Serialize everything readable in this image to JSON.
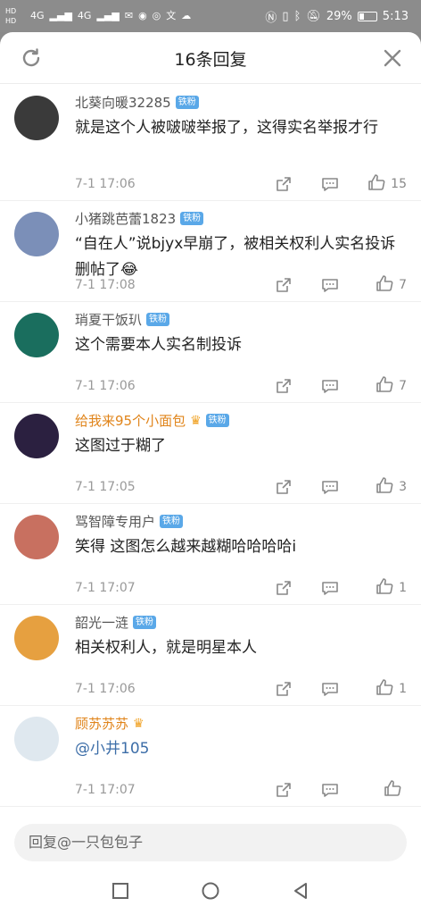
{
  "status": {
    "hd": "HD",
    "network": "4G",
    "battery": "29%",
    "time": "5:13"
  },
  "header": {
    "title": "16条回复"
  },
  "fan_badge": "铁粉",
  "comments": [
    {
      "name": "北葵向暖32285",
      "highlight": false,
      "crown": false,
      "badge": true,
      "text": "就是这个人被啵啵举报了，这得实名举报才行",
      "time": "7-1 17:06",
      "likes": "15",
      "avatar_color": "#3a3a3a"
    },
    {
      "name": "小猪跳芭蕾1823",
      "highlight": false,
      "crown": false,
      "badge": true,
      "text": "“自在人”说bjyx早崩了，被相关权利人实名投诉删帖了😂",
      "time": "7-1 17:08",
      "likes": "7",
      "avatar_color": "#7b8fb8"
    },
    {
      "name": "琑夏干饭玐",
      "highlight": false,
      "crown": false,
      "badge": true,
      "text": "这个需要本人实名制投诉",
      "time": "7-1 17:06",
      "likes": "7",
      "avatar_color": "#1a6e5e"
    },
    {
      "name": "给我来95个小面包",
      "highlight": true,
      "crown": true,
      "badge": true,
      "text": "这图过于糊了",
      "time": "7-1 17:05",
      "likes": "3",
      "avatar_color": "#2b2040"
    },
    {
      "name": "骂智障专用户",
      "highlight": false,
      "crown": false,
      "badge": true,
      "text": "笑得 这图怎么越来越糊哈哈哈哈i",
      "time": "7-1 17:07",
      "likes": "1",
      "avatar_color": "#c87060"
    },
    {
      "name": "韶光一涟",
      "highlight": false,
      "crown": false,
      "badge": true,
      "text": "相关权利人，就是明星本人",
      "time": "7-1 17:06",
      "likes": "1",
      "avatar_color": "#e6a040"
    },
    {
      "name": "顾苏苏苏",
      "highlight": true,
      "crown": true,
      "badge": false,
      "text": "@小井105",
      "time": "7-1 17:07",
      "likes": "",
      "avatar_color": "#dfe8ef"
    }
  ],
  "composer": {
    "placeholder": "回复@一只包包子"
  },
  "icons": {
    "refresh": "refresh-icon",
    "close": "close-icon",
    "share": "share-icon",
    "comment": "comment-icon",
    "like": "thumbs-up-icon"
  }
}
